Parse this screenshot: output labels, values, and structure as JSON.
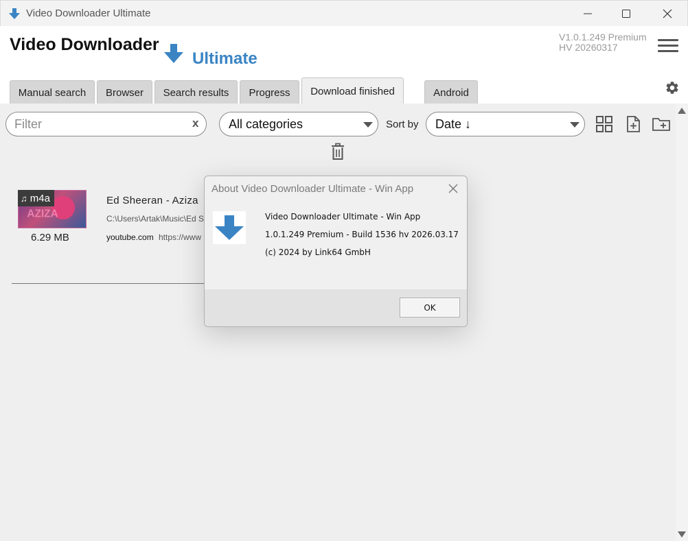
{
  "window": {
    "title": "Video Downloader Ultimate",
    "app_icon": "download-arrow-icon",
    "controls": [
      "minimize-icon",
      "maximize-icon",
      "close-icon"
    ]
  },
  "header": {
    "title": "Video Downloader",
    "subtitle": "Ultimate",
    "version_line1": "V1.0.1.249 Premium",
    "version_line2": "HV 20260317",
    "menu_icon": "hamburger-menu-icon",
    "settings_icon": "gear-icon"
  },
  "tabs": [
    {
      "label": "Manual search",
      "active": false
    },
    {
      "label": "Browser",
      "active": false
    },
    {
      "label": "Search results",
      "active": false
    },
    {
      "label": "Progress",
      "active": false
    },
    {
      "label": "Download finished",
      "active": true
    },
    {
      "label": "Android",
      "active": false
    }
  ],
  "toolbar": {
    "filter_placeholder": "Filter",
    "filter_clear": "x",
    "category_value": "All categories",
    "sort_label": "Sort by",
    "sort_value": "Date ↓",
    "icons": [
      "grid-view-icon",
      "add-file-icon",
      "add-folder-icon",
      "trash-icon"
    ]
  },
  "downloads": [
    {
      "format": "m4a",
      "thumbnail_text": "AZIZA",
      "size": "6.29 MB",
      "title": "Ed Sheeran - Aziza",
      "path": "C:\\Users\\Artak\\Music\\Ed S",
      "source": "youtube.com",
      "url": "https://www"
    }
  ],
  "about_dialog": {
    "title": "About Video Downloader Ultimate - Win App",
    "line1": "Video Downloader Ultimate - Win App",
    "line2": "1.0.1.249 Premium - Build 1536 hv 2026.03.17",
    "line3": "(c) 2024 by Link64 GmbH",
    "ok_label": "OK"
  },
  "colors": {
    "accent_blue": "#3a84c4",
    "content_bg": "#efefef",
    "tab_bg": "#d6d6d6"
  }
}
